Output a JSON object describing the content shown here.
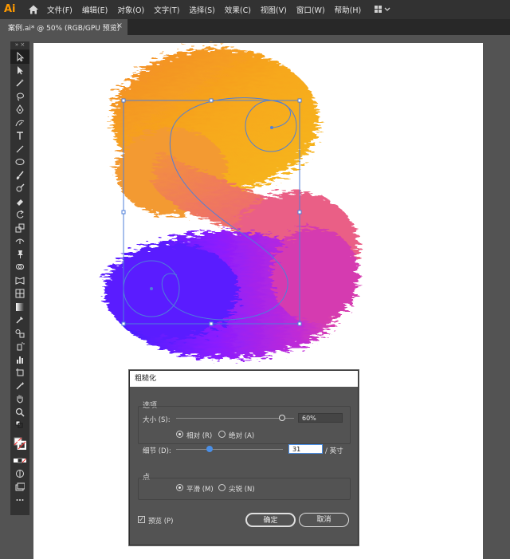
{
  "app": {
    "logo": "Ai"
  },
  "menu": [
    "文件(F)",
    "编辑(E)",
    "对象(O)",
    "文字(T)",
    "选择(S)",
    "效果(C)",
    "视图(V)",
    "窗口(W)",
    "帮助(H)"
  ],
  "document_tab": {
    "title": "案例.ai* @ 50% (RGB/GPU 预览)",
    "close": "×"
  },
  "toolbar": {
    "collapse": "»  ×"
  },
  "dialog": {
    "title": "粗糙化",
    "options_label": "选项",
    "size_label": "大小 (S):",
    "size_value": "60%",
    "size_level": 0.6,
    "relative_label": "相对 (R)",
    "absolute_label": "绝对 (A)",
    "detail_label": "细节 (D):",
    "detail_value": "31",
    "detail_unit": "/ 英寸",
    "detail_level": 0.31,
    "points_label": "点",
    "smooth_label": "平滑 (M)",
    "corner_label": "尖锐 (N)",
    "preview_label": "预览 (P)",
    "ok_label": "确定",
    "cancel_label": "取消"
  },
  "colors": {
    "accent": "#4a8fe7",
    "orange": "#f7a81b",
    "pink": "#e8509a",
    "purple": "#8a1cff",
    "blue": "#3a1cff"
  }
}
